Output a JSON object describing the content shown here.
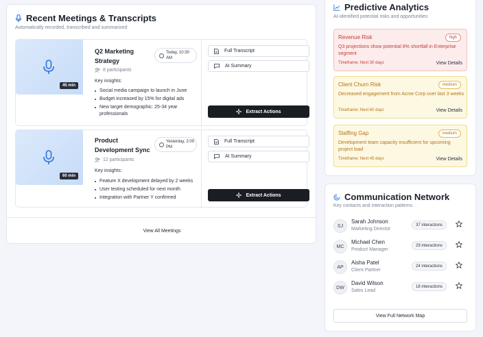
{
  "meetings_panel": {
    "title": "Recent Meetings & Transcripts",
    "subtitle": "Automatically recorded, transcribed and summarized",
    "view_all_label": "View All Meetings",
    "meetings": [
      {
        "title": "Q2 Marketing Strategy",
        "time": "Today, 10:30 AM",
        "participants": "8 participants",
        "duration": "45 min",
        "key_insights_label": "Key insights:",
        "insights": [
          "Social media campaign to launch in June",
          "Budget increased by 15% for digital ads",
          "New target demographic: 25-34 year professionals"
        ],
        "transcript_label": "Full Transcript",
        "summary_label": "AI Summary",
        "extract_label": "Extract Actions"
      },
      {
        "title": "Product Development Sync",
        "time": "Yesterday, 2:00 PM",
        "participants": "12 participants",
        "duration": "60 min",
        "key_insights_label": "Key insights:",
        "insights": [
          "Feature X development delayed by 2 weeks",
          "User testing scheduled for next month",
          "Integration with Partner Y confirmed"
        ],
        "transcript_label": "Full Transcript",
        "summary_label": "AI Summary",
        "extract_label": "Extract Actions"
      }
    ]
  },
  "analytics_panel": {
    "title": "Predictive Analytics",
    "subtitle": "AI-identified potential risks and opportunities",
    "risks": [
      {
        "title": "Revenue Risk",
        "badge": "high",
        "description": "Q3 projections show potential 8% shortfall in Enterprise segment",
        "timeframe": "Timeframe: Next 30 days",
        "link": "View Details"
      },
      {
        "title": "Client Churn Risk",
        "badge": "medium",
        "description": "Decreased engagement from Acme Corp over last 3 weeks",
        "timeframe": "Timeframe: Next 60 days",
        "link": "View Details"
      },
      {
        "title": "Staffing Gap",
        "badge": "medium",
        "description": "Development team capacity insufficient for upcoming project load",
        "timeframe": "Timeframe: Next 45 days",
        "link": "View Details"
      }
    ]
  },
  "network_panel": {
    "title": "Communication Network",
    "subtitle": "Key contacts and interaction patterns",
    "contacts": [
      {
        "initials": "SJ",
        "name": "Sarah Johnson",
        "role": "Marketing Director",
        "interactions": "37 interactions"
      },
      {
        "initials": "MC",
        "name": "Michael Chen",
        "role": "Product Manager",
        "interactions": "29 interactions"
      },
      {
        "initials": "AP",
        "name": "Aisha Patel",
        "role": "Client Partner",
        "interactions": "24 interactions"
      },
      {
        "initials": "DW",
        "name": "David Wilson",
        "role": "Sales Lead",
        "interactions": "18 interactions"
      }
    ],
    "button_label": "View Full Network Map"
  },
  "colors": {
    "accent": "#3b7de0",
    "risk_high": "#c43a3a",
    "risk_medium": "#b3741b",
    "dark_button": "#1a1d24"
  },
  "icons": {
    "meetings": "microphone-icon",
    "analytics": "trend-chart-icon",
    "network": "network-icon",
    "transcript": "document-icon",
    "summary": "chat-bubble-icon",
    "extract": "sparkle-icon",
    "participants": "users-icon",
    "time": "clock-icon",
    "favorite": "star-icon"
  }
}
